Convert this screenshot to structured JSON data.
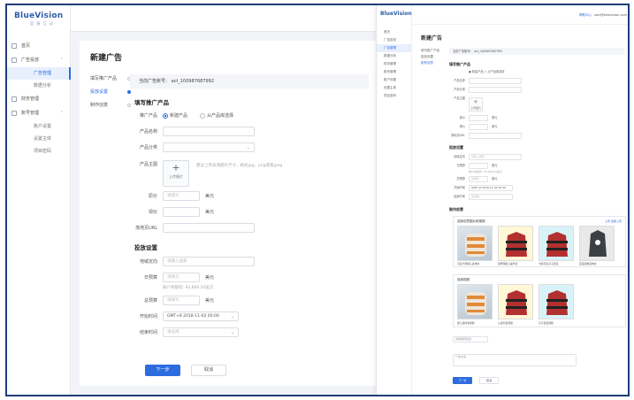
{
  "app": {
    "logo": "BlueVision",
    "logo_sub": "蓝 瀚 互 动",
    "help": "帮助"
  },
  "sidebar": {
    "items": [
      {
        "label": "首页",
        "icon": "home-icon"
      },
      {
        "label": "广告投放",
        "icon": "megaphone-icon"
      },
      {
        "label": "广告管理",
        "sub": true,
        "active": true
      },
      {
        "label": "数据分析",
        "sub": true
      },
      {
        "label": "财务管理",
        "icon": "wallet-icon"
      },
      {
        "label": "账号管理",
        "icon": "user-icon"
      },
      {
        "label": "账户设置",
        "sub": true
      },
      {
        "label": "设置主体",
        "sub": true
      },
      {
        "label": "项目密码",
        "sub": true
      }
    ]
  },
  "page": {
    "title": "新建广告",
    "steps": [
      "填写推广产品",
      "投放设置",
      "制作创意"
    ],
    "account": "当前广告账号：   act_100987687992"
  },
  "form": {
    "section1": "填写推广产品",
    "product_type_label": "推广产品",
    "radio_new": "新建产品",
    "radio_existing": "从产品库选择",
    "product_name_label": "产品名称",
    "product_category_label": "产品分类",
    "product_image_label": "产品主图",
    "upload_text": "上传图片",
    "upload_hint": "建议上传高清图片尺寸，格式jpg、png或者jpeg",
    "original_price_label": "原价",
    "original_price_placeholder": "请填写",
    "current_price_label": "现价",
    "currency": "美元",
    "landing_label": "落地页URL",
    "section2": "投放设置",
    "region_label": "地域定向",
    "region_placeholder": "请输入国家",
    "daily_budget_label": "日预算",
    "daily_budget_placeholder": "请填写",
    "budget_hint": "账户余额有: 93,866.50美元",
    "total_budget_label": "总预算",
    "total_budget_placeholder": "请填写",
    "start_label": "开始时间",
    "start_value": "GMT+8 2018-11-02 00:00",
    "end_label": "结束时间",
    "end_placeholder": "请选择",
    "next_button": "下一步",
    "cancel_button": "取消"
  },
  "preview": {
    "logo": "BlueVision",
    "top_link": "帮助中心",
    "top_user": "user@bluevision.com",
    "nav": [
      "首页",
      "广告投放",
      "广告管理",
      "数据分析",
      "财务管理",
      "账号管理",
      "账户设置",
      "设置主体",
      "项目密码"
    ],
    "title": "新建广告",
    "steps": [
      "填写推广产品",
      "投放设置",
      "制作创意"
    ],
    "account": "当前广告账号：   act_100987687992",
    "section1": "填写推广产品",
    "radios": "● 新建产品   ○ 从产品库选择",
    "fields": [
      "产品名称",
      "产品分类",
      "产品主图"
    ],
    "upload_text": "上传图片",
    "price1": "原价",
    "price2": "现价",
    "unit": "美元",
    "landing": "落地页URL",
    "section2": "投放设置",
    "region": "地域定向",
    "region_ph": "请输入国家",
    "daily": "日预算",
    "daily_hint": "账户余额有: 93,866.50美元",
    "total": "总预算",
    "total_ph": "请填写",
    "start": "开始时间",
    "start_value": "GMT+8 2018-11-02 00:00",
    "end": "结束时间",
    "end_ph": "请选择",
    "section3": "制作创意",
    "box1_title": "选择创意图片和视频",
    "box1_tools": "上传   批量上传",
    "box1_caps": [
      "可爱卡通婴儿连体衣",
      "加厚保暖儿童外套",
      "卡通可爱亲子套装",
      "宝宝连帽连体衣"
    ],
    "box2_title": "选择视频",
    "box2_caps": [
      "婴儿连体衣视频",
      "儿童外套视频",
      "亲子套装视频"
    ],
    "link_label": "选择跳转链接",
    "text_label": "广告文案",
    "next_button": "下一步",
    "cancel_button": "取消"
  }
}
